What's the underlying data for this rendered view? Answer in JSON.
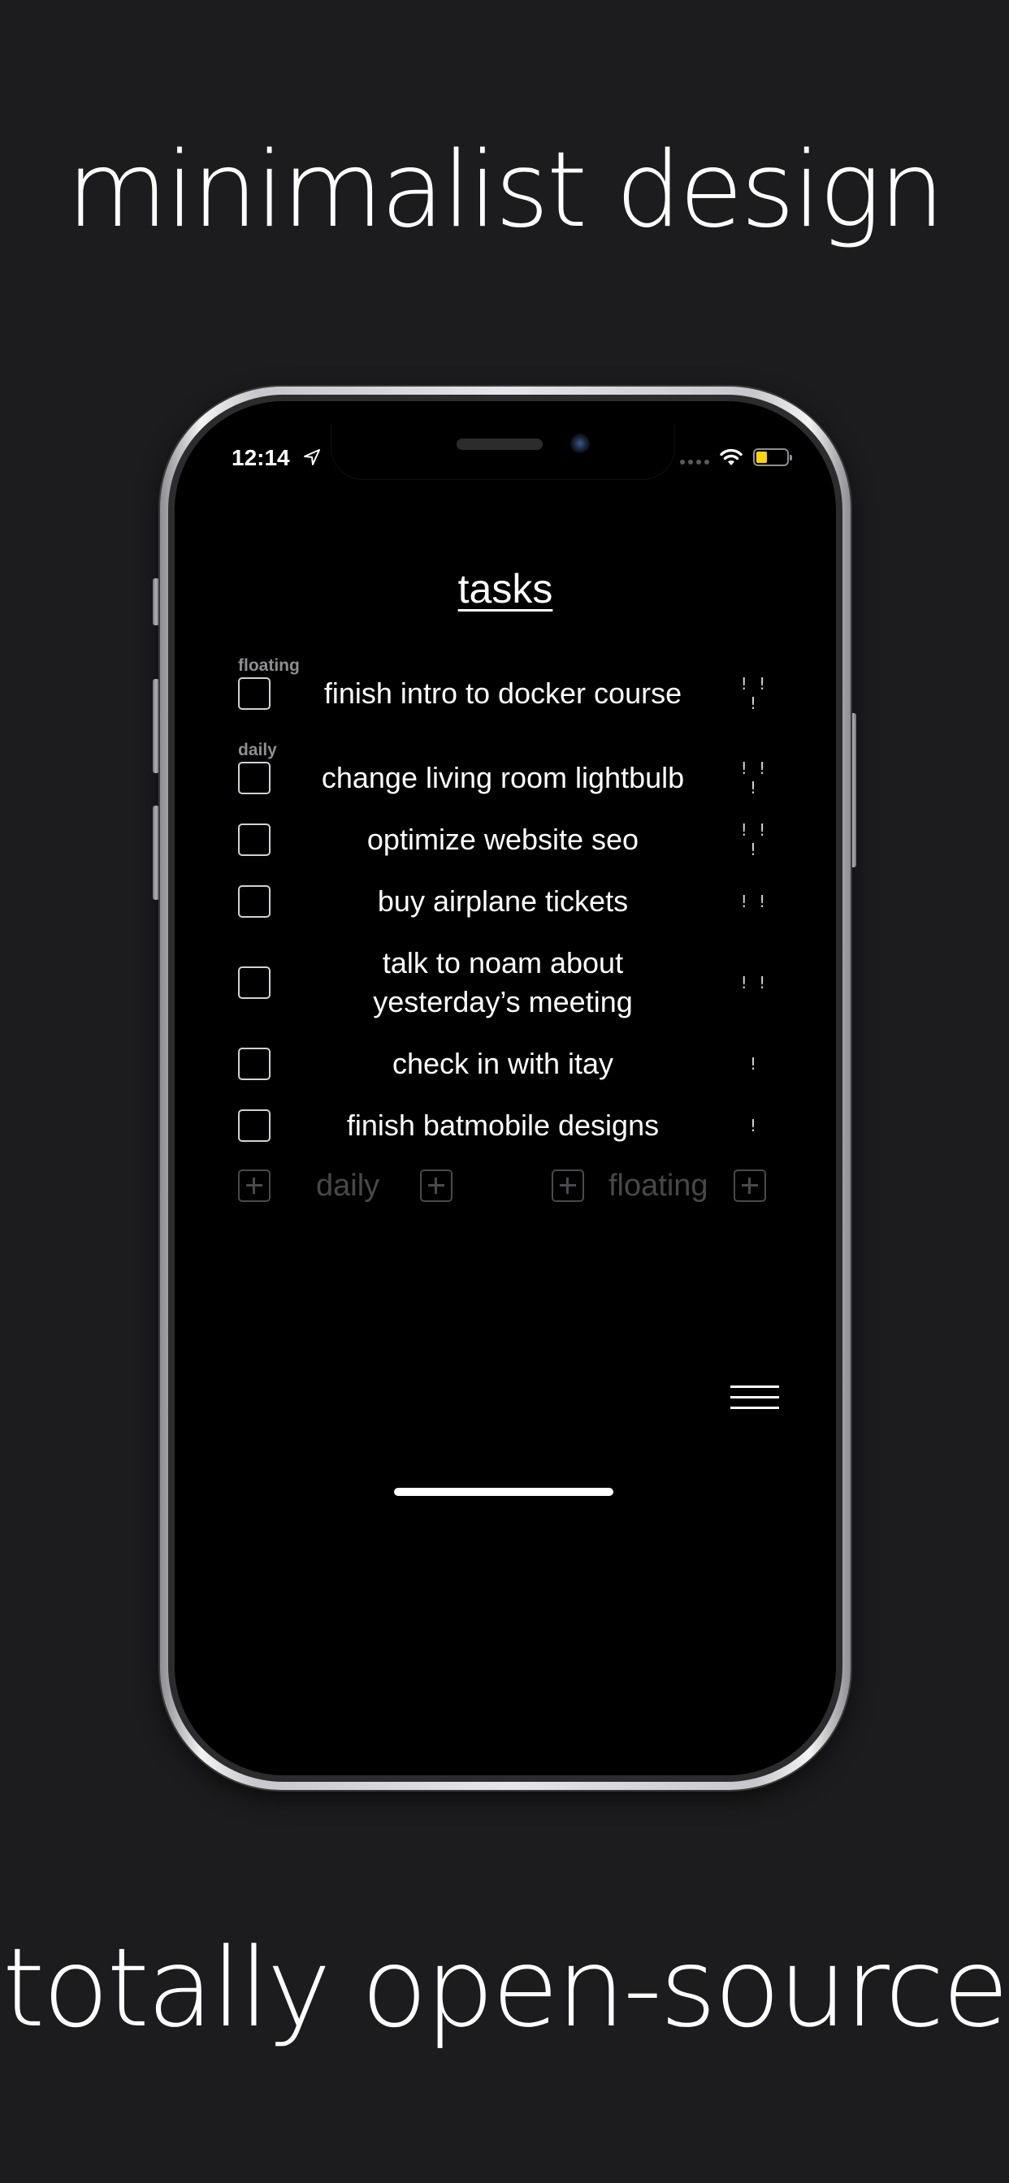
{
  "headlines": {
    "top": "minimalist design",
    "bottom": "totally open-source"
  },
  "status_bar": {
    "time": "12:14",
    "location_icon": "location-arrow-icon",
    "wifi_icon": "wifi-icon",
    "battery_icon": "battery-icon",
    "battery_level": 0.35,
    "battery_color": "#ffd60a"
  },
  "app": {
    "title": "tasks",
    "sections": {
      "floating": "floating",
      "daily": "daily"
    },
    "floating_tasks": [
      {
        "text": "finish intro to docker course",
        "priority": "! ! !"
      }
    ],
    "daily_tasks": [
      {
        "text": "change living room lightbulb",
        "priority": "! ! !"
      },
      {
        "text": "optimize website seo",
        "priority": "! ! !"
      },
      {
        "text": "buy airplane tickets",
        "priority": "! !"
      },
      {
        "text": "talk to noam about yesterday’s meeting",
        "priority": "! !"
      },
      {
        "text": "check in with itay",
        "priority": "!"
      },
      {
        "text": "finish batmobile designs",
        "priority": "!"
      }
    ],
    "add_row": {
      "daily_label": "daily",
      "floating_label": "floating"
    },
    "menu_icon": "hamburger-menu-icon"
  },
  "colors": {
    "background": "#1c1c1e",
    "screen": "#000000",
    "text": "#ffffff",
    "muted_label": "#8e8e93",
    "add_controls": "#48484a"
  }
}
